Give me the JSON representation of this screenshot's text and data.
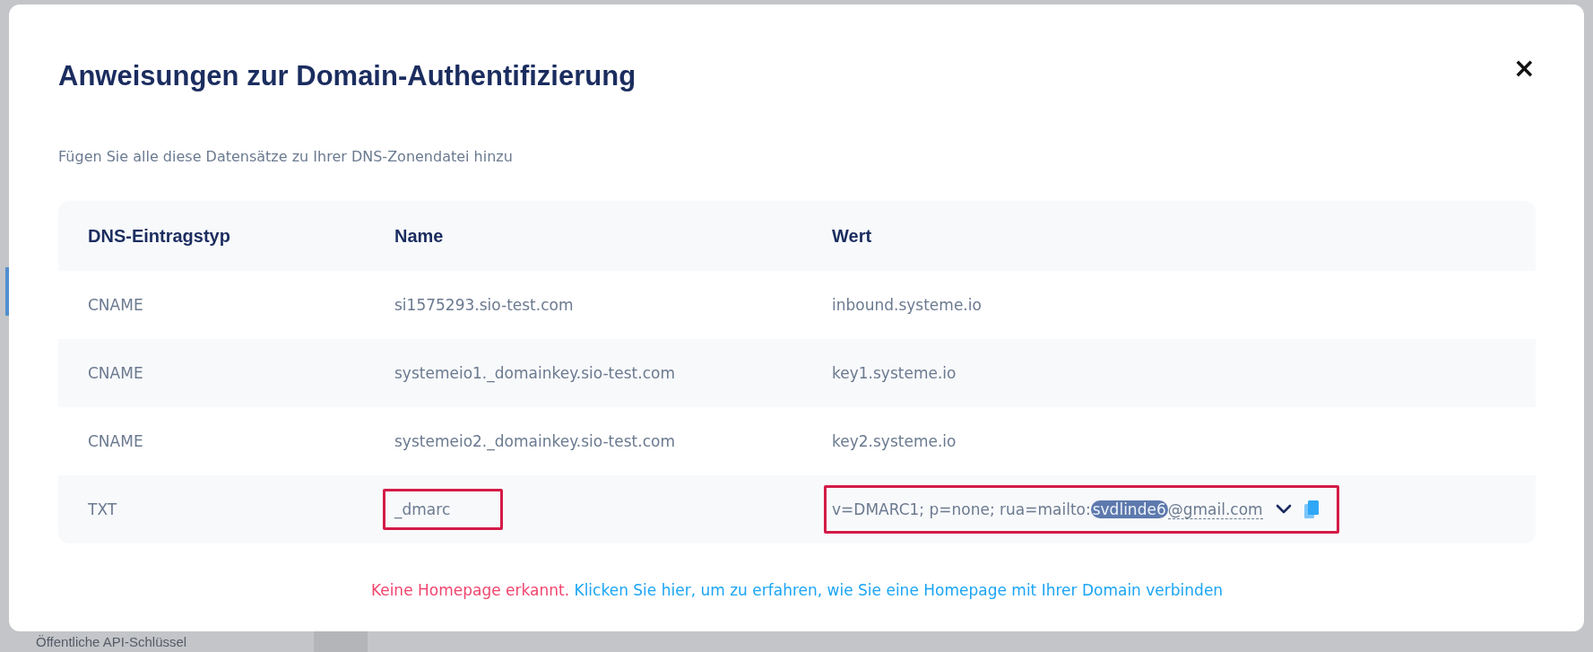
{
  "background": {
    "sidebar_item": "Öffentliche API-Schlüssel"
  },
  "dialog": {
    "title": "Anweisungen zur Domain-Authentifizierung",
    "close": "×",
    "subtitle": "Fügen Sie alle diese Datensätze zu Ihrer DNS-Zonendatei hinzu"
  },
  "table": {
    "columns": [
      "DNS-Eintragstyp",
      "Name",
      "Wert"
    ],
    "rows": [
      {
        "type": "CNAME",
        "name": {
          "text": "si1575293.sio-test.com",
          "highlighted": false
        },
        "value": {
          "highlighted": false,
          "expandable": false,
          "parts": [
            {
              "kind": "plain",
              "text": "inbound.systeme.io"
            }
          ]
        }
      },
      {
        "type": "CNAME",
        "name": {
          "text": "systemeio1._domainkey.sio-test.com",
          "highlighted": false
        },
        "value": {
          "highlighted": false,
          "expandable": false,
          "parts": [
            {
              "kind": "plain",
              "text": "key1.systeme.io"
            }
          ]
        }
      },
      {
        "type": "CNAME",
        "name": {
          "text": "systemeio2._domainkey.sio-test.com",
          "highlighted": false
        },
        "value": {
          "highlighted": false,
          "expandable": false,
          "parts": [
            {
              "kind": "plain",
              "text": "key2.systeme.io"
            }
          ]
        }
      },
      {
        "type": "TXT",
        "name": {
          "text": "_dmarc",
          "highlighted": true
        },
        "value": {
          "highlighted": true,
          "expandable": true,
          "parts": [
            {
              "kind": "plain",
              "text": "v=DMARC1; p=none; rua=mailto:"
            },
            {
              "kind": "redacted",
              "text": "svdlinde6"
            },
            {
              "kind": "underlined",
              "text": "@gmail.com"
            }
          ]
        }
      }
    ]
  },
  "notice": {
    "warning": "Keine Homepage erkannt.",
    "link": "Klicken Sie hier, um zu erfahren, wie Sie eine Homepage mit Ihrer Domain verbinden"
  }
}
